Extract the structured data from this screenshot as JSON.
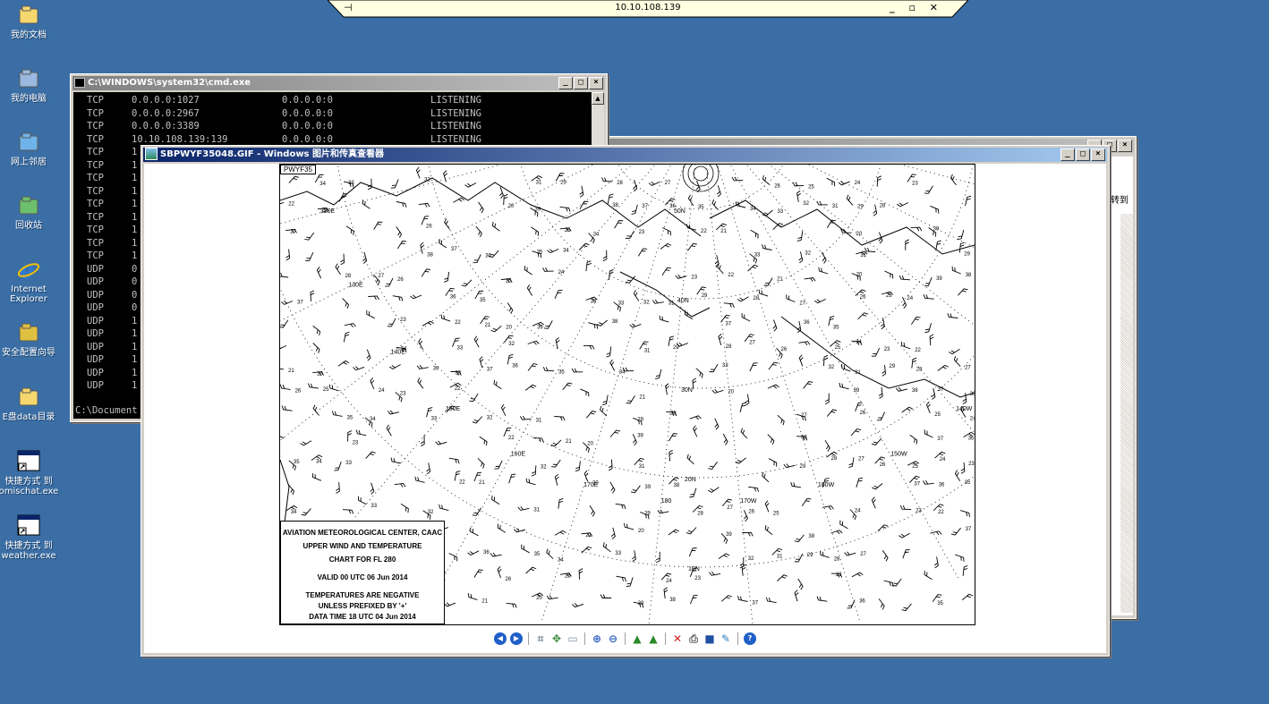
{
  "rdp_bar": {
    "title": "10.10.108.139",
    "pin": "⊣",
    "controls": "_ ▫ ✕"
  },
  "desktop": {
    "icons": [
      {
        "label": "我的文档",
        "icon": "my-documents-icon"
      },
      {
        "label": "我的电脑",
        "icon": "my-computer-icon"
      },
      {
        "label": "网上邻居",
        "icon": "network-places-icon"
      },
      {
        "label": "回收站",
        "icon": "recycle-bin-icon"
      },
      {
        "label": "Internet Explorer",
        "icon": "internet-explorer-icon"
      },
      {
        "label": "安全配置向导",
        "icon": "security-wizard-icon"
      },
      {
        "label": "E盘data目录",
        "icon": "folder-icon"
      },
      {
        "label": "快捷方式 到 omischat.exe",
        "icon": "shortcut-icon"
      },
      {
        "label": "快捷方式 到 weather.exe",
        "icon": "shortcut-icon"
      }
    ]
  },
  "cmd": {
    "title": "C:\\WINDOWS\\system32\\cmd.exe",
    "rows": [
      [
        "TCP",
        "0.0.0.0:1027",
        "0.0.0.0:0",
        "LISTENING"
      ],
      [
        "TCP",
        "0.0.0.0:2967",
        "0.0.0.0:0",
        "LISTENING"
      ],
      [
        "TCP",
        "0.0.0.0:3389",
        "0.0.0.0:0",
        "LISTENING"
      ],
      [
        "TCP",
        "10.10.108.139:139",
        "0.0.0.0:0",
        "LISTENING"
      ],
      [
        "TCP",
        "1",
        "",
        ""
      ],
      [
        "TCP",
        "1",
        "",
        ""
      ],
      [
        "TCP",
        "1",
        "",
        ""
      ],
      [
        "TCP",
        "1",
        "",
        ""
      ],
      [
        "TCP",
        "1",
        "",
        ""
      ],
      [
        "TCP",
        "1",
        "",
        ""
      ],
      [
        "TCP",
        "1",
        "",
        ""
      ],
      [
        "TCP",
        "1",
        "",
        ""
      ],
      [
        "TCP",
        "1",
        "",
        ""
      ],
      [
        "UDP",
        "0",
        "",
        ""
      ],
      [
        "UDP",
        "0",
        "",
        ""
      ],
      [
        "UDP",
        "0",
        "",
        ""
      ],
      [
        "UDP",
        "0",
        "",
        ""
      ],
      [
        "UDP",
        "1",
        "",
        ""
      ],
      [
        "UDP",
        "1",
        "",
        ""
      ],
      [
        "UDP",
        "1",
        "",
        ""
      ],
      [
        "UDP",
        "1",
        "",
        ""
      ],
      [
        "UDP",
        "1",
        "",
        ""
      ],
      [
        "UDP",
        "1",
        "",
        ""
      ]
    ],
    "prompt": "C:\\Document"
  },
  "explorer": {
    "go_label": "转到"
  },
  "viewer": {
    "title": "SBPWYF35048.GIF - Windows 图片和传真查看器",
    "chart": {
      "tag": "PWYF35",
      "legend": [
        "AVIATION METEOROLOGICAL CENTER, CAAC",
        "UPPER WIND AND TEMPERATURE",
        "CHART FOR FL 280",
        "VALID 00 UTC 06 Jun 2014",
        "TEMPERATURES ARE NEGATIVE",
        "UNLESS PREFIXED BY '+'",
        "DATA TIME 18 UTC 04 Jun 2014"
      ],
      "lat_labels": [
        "50N",
        "40N",
        "30N",
        "20N",
        "10N"
      ],
      "lon_labels": [
        "120E",
        "130E",
        "140E",
        "150E",
        "160E",
        "170E",
        "180",
        "170W",
        "160W",
        "150W",
        "140W",
        "130W",
        "120W",
        "110W"
      ],
      "temps": [
        "34",
        "33",
        "32",
        "31",
        "29",
        "28",
        "27",
        "26",
        "25",
        "24",
        "23",
        "22",
        "21",
        "20",
        "39",
        "38",
        "37",
        "36",
        "35"
      ]
    },
    "toolbar": [
      "previous-image-icon",
      "next-image-icon",
      "best-fit-icon",
      "actual-size-icon",
      "slideshow-icon",
      "zoom-in-icon",
      "zoom-out-icon",
      "rotate-clockwise-icon",
      "rotate-counterclockwise-icon",
      "delete-icon",
      "print-icon",
      "save-icon",
      "edit-icon",
      "help-icon"
    ]
  },
  "colors": {
    "desktop": "#3a6ea5",
    "titlebar_active": "#0a246a",
    "titlebar_inactive": "#808080"
  }
}
